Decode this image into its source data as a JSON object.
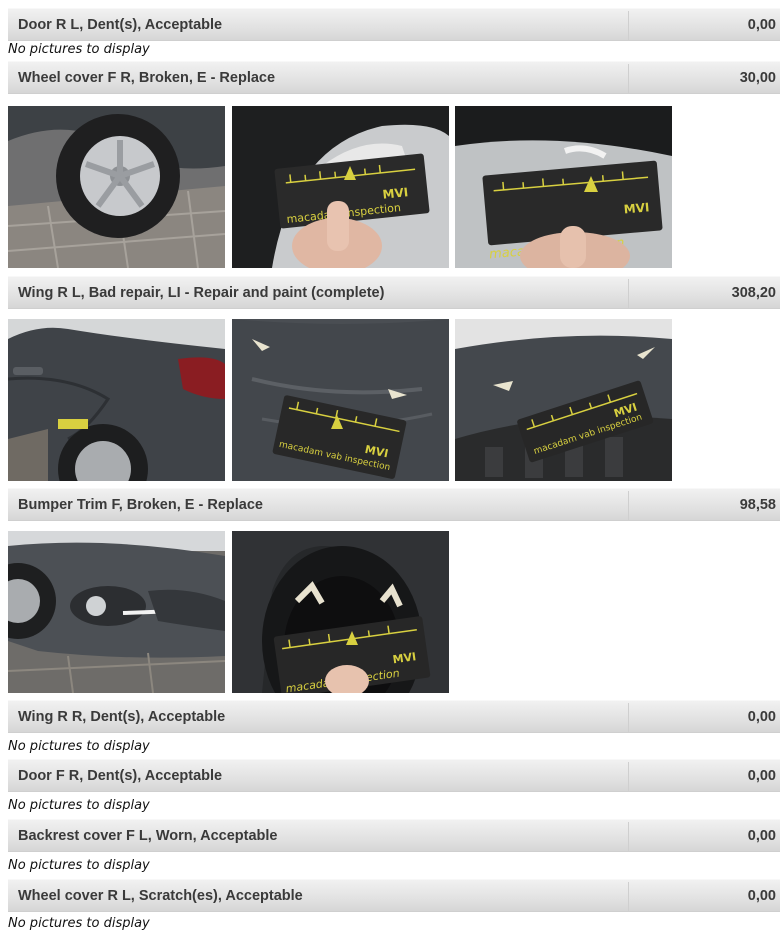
{
  "no_pictures_text": "No pictures to display",
  "items": [
    {
      "description": "Door R L, Dent(s), Acceptable",
      "price": "0,00"
    },
    {
      "description": "Wheel cover F R, Broken, E - Replace",
      "price": "30,00"
    },
    {
      "description": "Wing R L, Bad repair, LI - Repair and paint (complete)",
      "price": "308,20"
    },
    {
      "description": "Bumper Trim F, Broken, E - Replace",
      "price": "98,58"
    },
    {
      "description": "Wing R R, Dent(s), Acceptable",
      "price": "0,00"
    },
    {
      "description": "Door F R, Dent(s), Acceptable",
      "price": "0,00"
    },
    {
      "description": "Backrest cover F L, Worn, Acceptable",
      "price": "0,00"
    },
    {
      "description": "Wheel cover R L, Scratch(es), Acceptable",
      "price": "0,00"
    }
  ],
  "gauge_card": {
    "logo_text": "MVI",
    "brand_text_1": "macadam inspection",
    "brand_text_2": "macadam vab inspection",
    "brand_text_3": "macadam inspection"
  }
}
